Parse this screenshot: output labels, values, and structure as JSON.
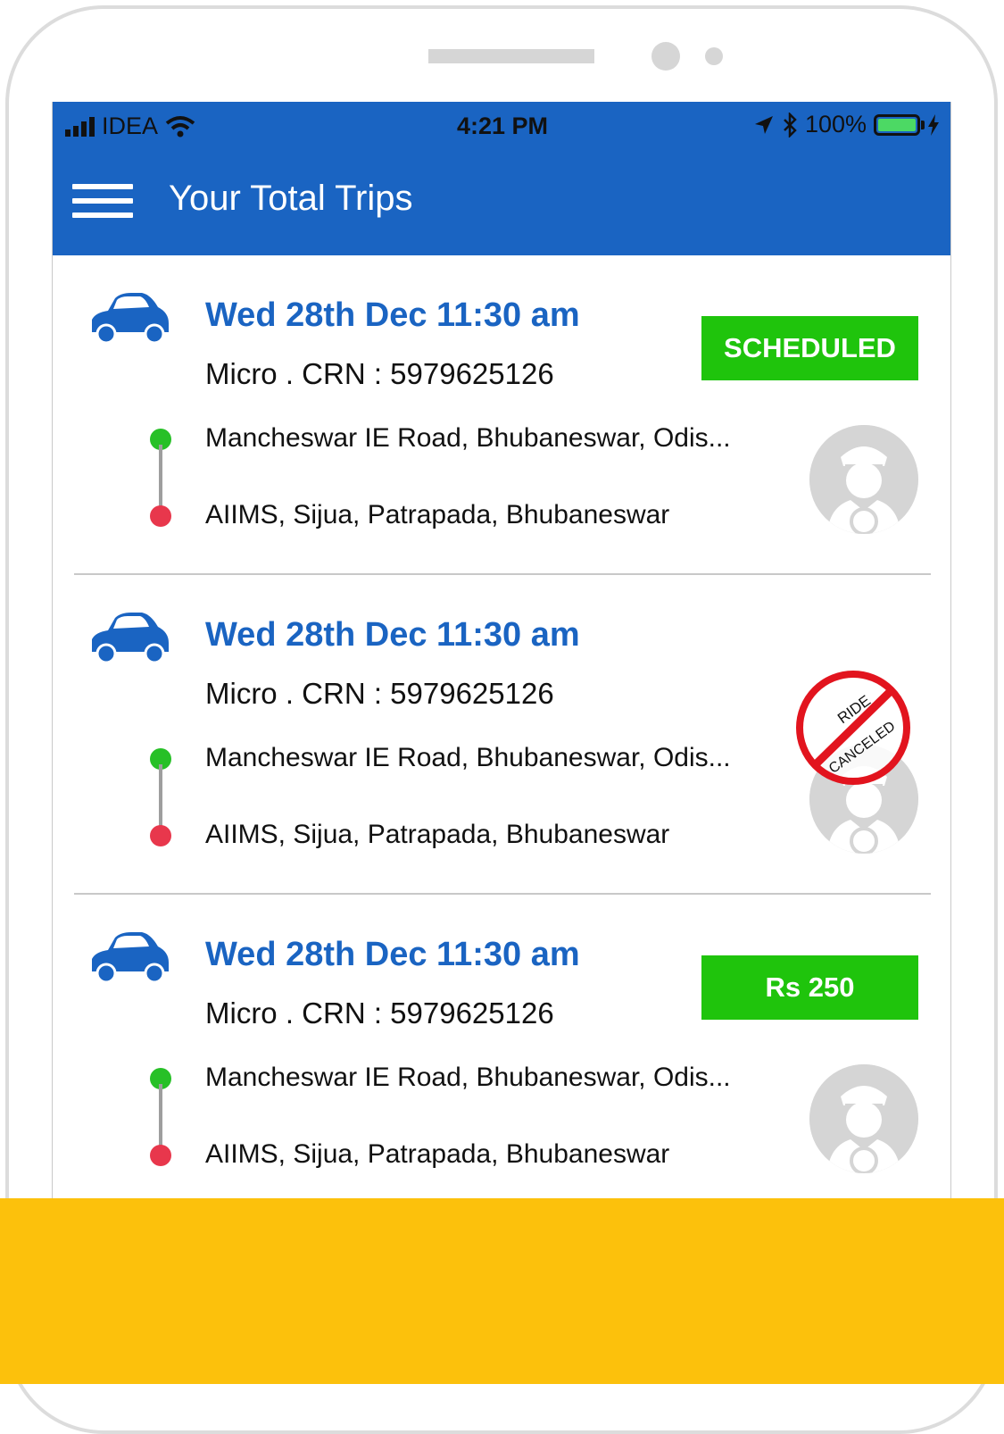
{
  "status_bar": {
    "carrier": "IDEA",
    "time": "4:21 PM",
    "battery": "100%"
  },
  "app_bar": {
    "title": "Your Total Trips"
  },
  "trips": [
    {
      "date": "Wed 28th Dec 11:30 am",
      "meta": "Micro .  CRN : 5979625126",
      "pickup": "Mancheswar IE Road, Bhubaneswar, Odis...",
      "drop": "AIIMS, Sijua, Patrapada, Bhubaneswar",
      "badge": "SCHEDULED"
    },
    {
      "date": "Wed 28th Dec 11:30 am",
      "meta": "Micro .  CRN : 5979625126",
      "pickup": "Mancheswar IE Road, Bhubaneswar, Odis...",
      "drop": "AIIMS, Sijua, Patrapada, Bhubaneswar",
      "stamp_top": "RIDE",
      "stamp_bottom": "CANCELED"
    },
    {
      "date": "Wed 28th Dec 11:30 am",
      "meta": "Micro .  CRN : 5979625126",
      "pickup": "Mancheswar IE Road, Bhubaneswar, Odis...",
      "drop": "AIIMS, Sijua, Patrapada, Bhubaneswar",
      "badge": "Rs 250"
    }
  ],
  "colors": {
    "primary": "#1a64c2",
    "badge_green": "#1fc40c",
    "pickup_dot": "#27c027",
    "drop_dot": "#e8374c",
    "accent_band": "#fcc10c"
  }
}
